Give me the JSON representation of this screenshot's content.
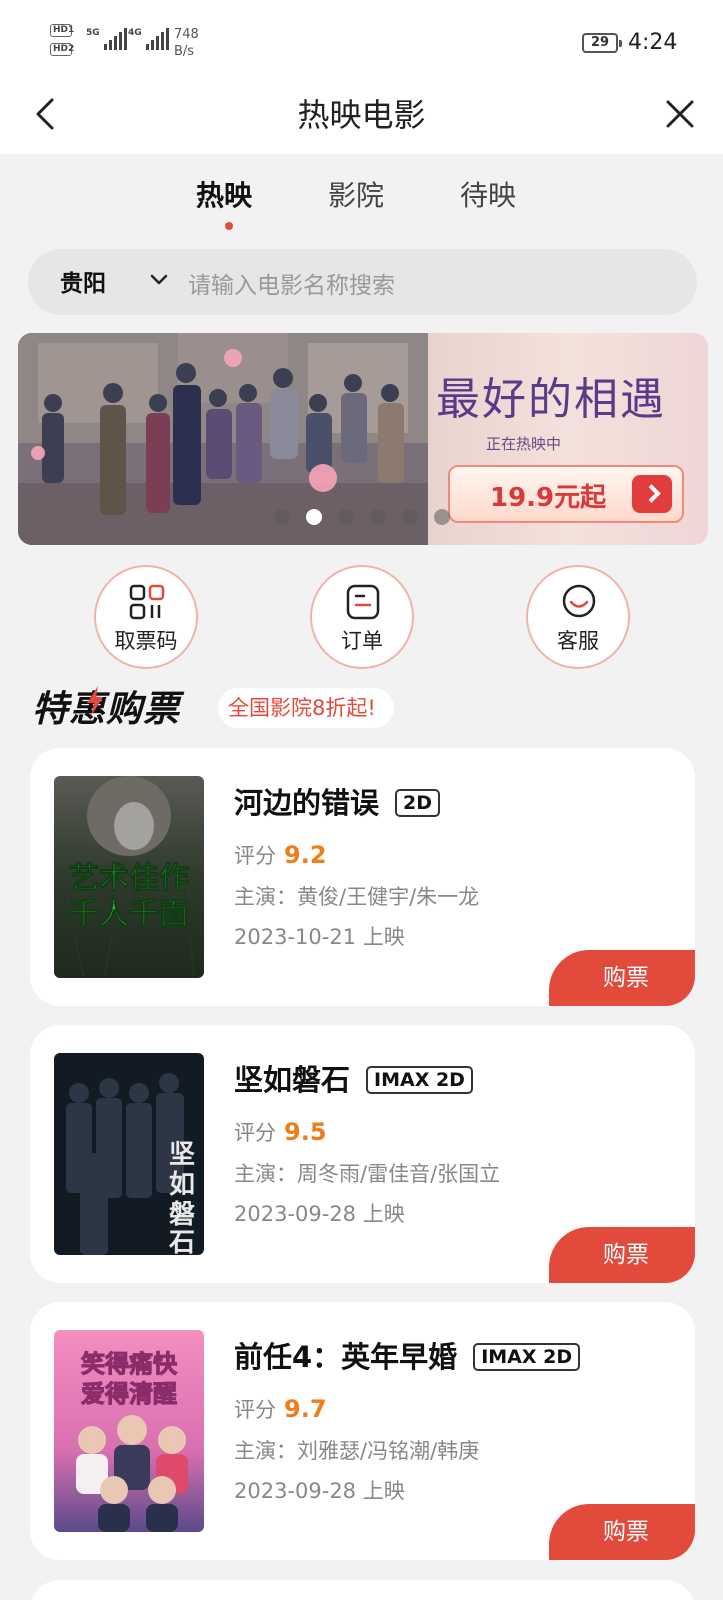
{
  "status_bar": {
    "hd1": "HD1",
    "hd2": "HD2",
    "net1": "5G",
    "net2": "4G",
    "speed_value": "748",
    "speed_unit": "B/s",
    "battery": "29",
    "time": "4:24"
  },
  "header": {
    "title": "热映电影"
  },
  "tabs": [
    {
      "label": "热映",
      "active": true
    },
    {
      "label": "影院",
      "active": false
    },
    {
      "label": "待映",
      "active": false
    }
  ],
  "search": {
    "city": "贵阳",
    "placeholder": "请输入电影名称搜索"
  },
  "banner": {
    "title": "最好的相遇",
    "subtitle": "正在热映中",
    "price": "19.9元起",
    "slide_count": 6,
    "active_slide": 2
  },
  "quick_actions": [
    {
      "label": "取票码",
      "icon": "ticket-code-icon"
    },
    {
      "label": "订单",
      "icon": "order-icon"
    },
    {
      "label": "客服",
      "icon": "customer-service-icon"
    }
  ],
  "promo": {
    "title": "特惠购票",
    "tag": "全国影院8折起!"
  },
  "movies": [
    {
      "name": "河边的错误",
      "format": "2D",
      "rating_label": "评分",
      "rating": "9.2",
      "cast": "主演：黄俊/王健宇/朱一龙",
      "date": "2023-10-21 上映",
      "buy": "购票",
      "poster_text": "艺术佳作 千人千面"
    },
    {
      "name": "坚如磐石",
      "format": "IMAX 2D",
      "rating_label": "评分",
      "rating": "9.5",
      "cast": "主演：周冬雨/雷佳音/张国立",
      "date": "2023-09-28 上映",
      "buy": "购票",
      "poster_text": "坚如磐石"
    },
    {
      "name": "前任4：英年早婚",
      "format": "IMAX 2D",
      "rating_label": "评分",
      "rating": "9.7",
      "cast": "主演：刘雅瑟/冯铭潮/韩庚",
      "date": "2023-09-28 上映",
      "buy": "购票",
      "poster_text": "笑得痛快 爱得清醒"
    }
  ],
  "colors": {
    "accent": "#e24a3c",
    "rating": "#ef7d1a",
    "background": "#f2f2f2"
  }
}
